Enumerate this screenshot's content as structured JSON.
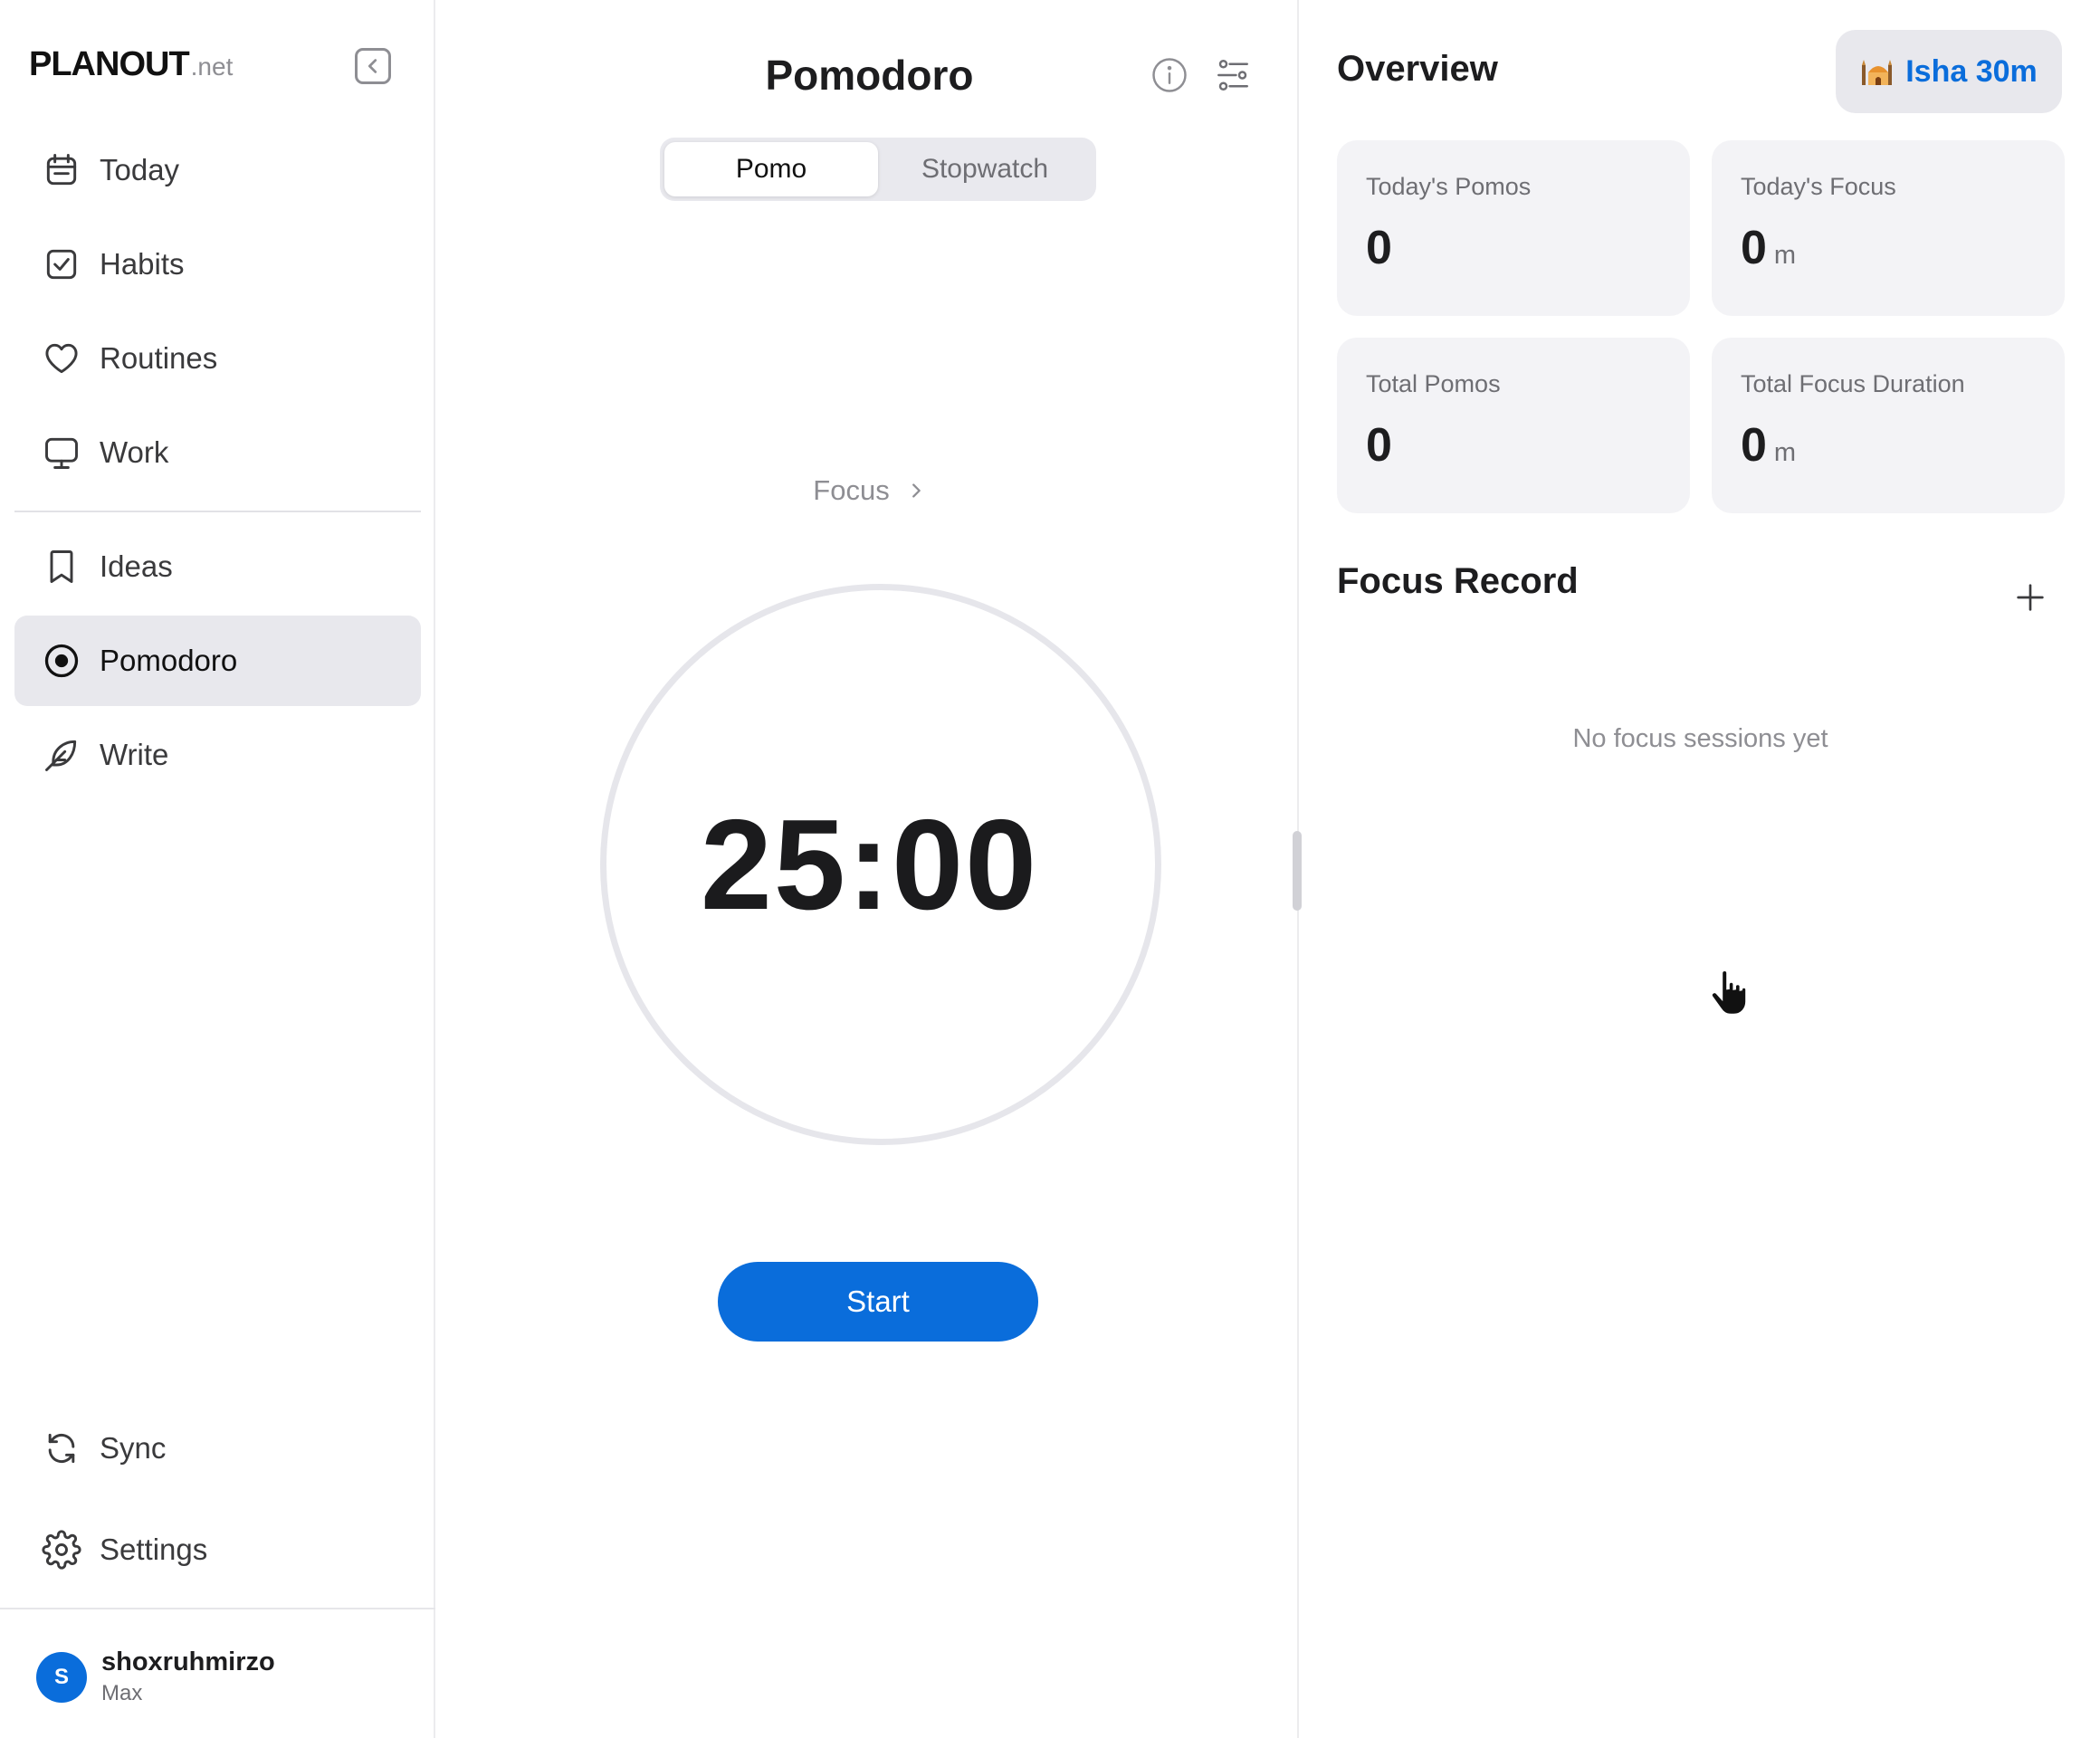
{
  "brand": {
    "name": "PLANOUT",
    "suffix": ".net"
  },
  "sidebar": {
    "items": [
      {
        "label": "Today",
        "icon": "calendar-icon"
      },
      {
        "label": "Habits",
        "icon": "checkbox-icon"
      },
      {
        "label": "Routines",
        "icon": "heart-icon"
      },
      {
        "label": "Work",
        "icon": "monitor-icon"
      },
      {
        "label": "Ideas",
        "icon": "bookmark-icon"
      },
      {
        "label": "Pomodoro",
        "icon": "target-icon",
        "active": true
      },
      {
        "label": "Write",
        "icon": "feather-icon"
      }
    ],
    "bottom": [
      {
        "label": "Sync",
        "icon": "sync-icon"
      },
      {
        "label": "Settings",
        "icon": "gear-icon"
      }
    ],
    "user": {
      "initial": "S",
      "name": "shoxruhmirzo",
      "plan": "Max"
    }
  },
  "pomodoro": {
    "title": "Pomodoro",
    "tabs": [
      "Pomo",
      "Stopwatch"
    ],
    "active_tab": "Pomo",
    "mode": "Focus",
    "timer": "25:00",
    "start_label": "Start"
  },
  "overview": {
    "title": "Overview",
    "prayer": "Isha 30m",
    "cards": [
      {
        "label": "Today's Pomos",
        "value": "0",
        "unit": ""
      },
      {
        "label": "Today's Focus",
        "value": "0",
        "unit": "m"
      },
      {
        "label": "Total Pomos",
        "value": "0",
        "unit": ""
      },
      {
        "label": "Total Focus Duration",
        "value": "0",
        "unit": "m"
      }
    ]
  },
  "focus_record": {
    "title": "Focus Record",
    "empty": "No focus sessions yet"
  },
  "colors": {
    "accent": "#0a6ddb",
    "active_bg": "#e8e8ed",
    "card_bg": "#f3f3f6"
  }
}
